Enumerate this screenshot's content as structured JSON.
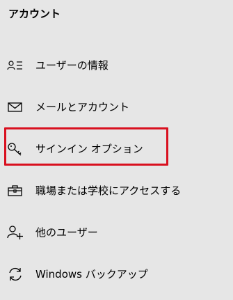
{
  "section": {
    "title": "アカウント"
  },
  "nav": {
    "items": [
      {
        "label": "ユーザーの情報",
        "icon": "user-info-icon"
      },
      {
        "label": "メールとアカウント",
        "icon": "mail-icon"
      },
      {
        "label": "サインイン オプション",
        "icon": "key-icon"
      },
      {
        "label": "職場または学校にアクセスする",
        "icon": "briefcase-icon"
      },
      {
        "label": "他のユーザー",
        "icon": "add-user-icon"
      },
      {
        "label": "Windows バックアップ",
        "icon": "sync-icon"
      }
    ]
  },
  "colors": {
    "background": "#e6e6e6",
    "text": "#000000",
    "highlight": "#d9101f"
  }
}
